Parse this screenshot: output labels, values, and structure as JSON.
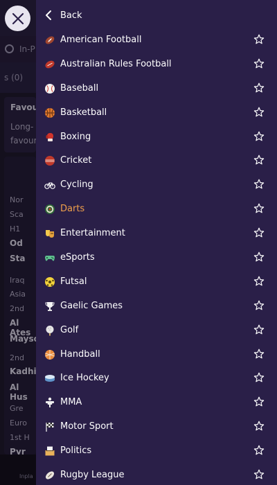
{
  "background": {
    "inplay_label": "In-P",
    "tab_label": "s (0)",
    "card_title": "Favou",
    "card_line1": "Long-",
    "card_line2": "favour",
    "groups": [
      "Nor",
      "Sca",
      "H1",
      "Od",
      "Sta",
      "Iraq",
      "Asia",
      "2nd",
      "Al Ates",
      "Mayso",
      "2nd",
      "Kadhi",
      "Al Hus",
      "Gre",
      "Euro",
      "1st H",
      "Pyr"
    ],
    "bottom_label": "Inpla"
  },
  "drawer": {
    "back_label": "Back",
    "accent": "#f0a04b",
    "items": [
      {
        "label": "American Football",
        "icon": "american-football-icon",
        "active": false
      },
      {
        "label": "Australian Rules Football",
        "icon": "australian-rules-football-icon",
        "active": false
      },
      {
        "label": "Baseball",
        "icon": "baseball-icon",
        "active": false
      },
      {
        "label": "Basketball",
        "icon": "basketball-icon",
        "active": false
      },
      {
        "label": "Boxing",
        "icon": "boxing-glove-icon",
        "active": false
      },
      {
        "label": "Cricket",
        "icon": "cricket-ball-icon",
        "active": false
      },
      {
        "label": "Cycling",
        "icon": "bicycle-icon",
        "active": false
      },
      {
        "label": "Darts",
        "icon": "dartboard-icon",
        "active": true
      },
      {
        "label": "Entertainment",
        "icon": "theatre-masks-icon",
        "active": false
      },
      {
        "label": "eSports",
        "icon": "gamepad-icon",
        "active": false
      },
      {
        "label": "Futsal",
        "icon": "futsal-ball-icon",
        "active": false
      },
      {
        "label": "Gaelic Games",
        "icon": "trophy-icon",
        "active": false
      },
      {
        "label": "Golf",
        "icon": "golf-ball-icon",
        "active": false
      },
      {
        "label": "Handball",
        "icon": "handball-icon",
        "active": false
      },
      {
        "label": "Ice Hockey",
        "icon": "hockey-puck-icon",
        "active": false
      },
      {
        "label": "MMA",
        "icon": "fighter-icon",
        "active": false
      },
      {
        "label": "Motor Sport",
        "icon": "chequered-flag-icon",
        "active": false
      },
      {
        "label": "Politics",
        "icon": "ballot-box-icon",
        "active": false
      },
      {
        "label": "Rugby League",
        "icon": "rugby-ball-icon",
        "active": false
      }
    ]
  }
}
